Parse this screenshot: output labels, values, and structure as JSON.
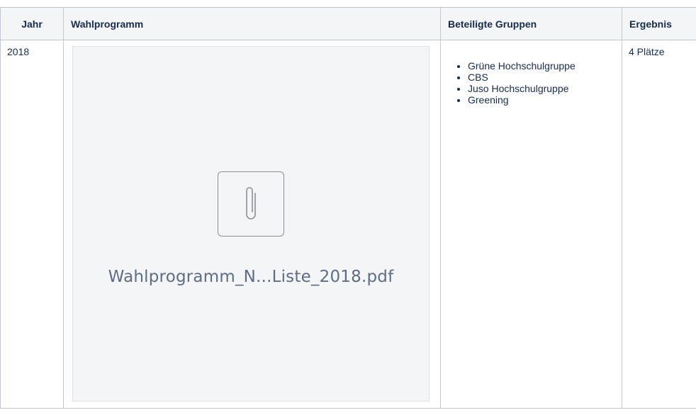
{
  "table": {
    "headers": {
      "jahr": "Jahr",
      "wahlprogramm": "Wahlprogramm",
      "gruppen": "Beteiligte Gruppen",
      "ergebnis": "Ergebnis"
    },
    "rows": [
      {
        "jahr": "2018",
        "attachment": {
          "icon": "paperclip-icon",
          "file_name": "Wahlprogramm_N...Liste_2018.pdf"
        },
        "gruppen": [
          "Grüne Hochschulgruppe",
          "CBS",
          "Juso Hochschulgruppe",
          "Greening"
        ],
        "ergebnis": "4 Plätze"
      }
    ]
  }
}
